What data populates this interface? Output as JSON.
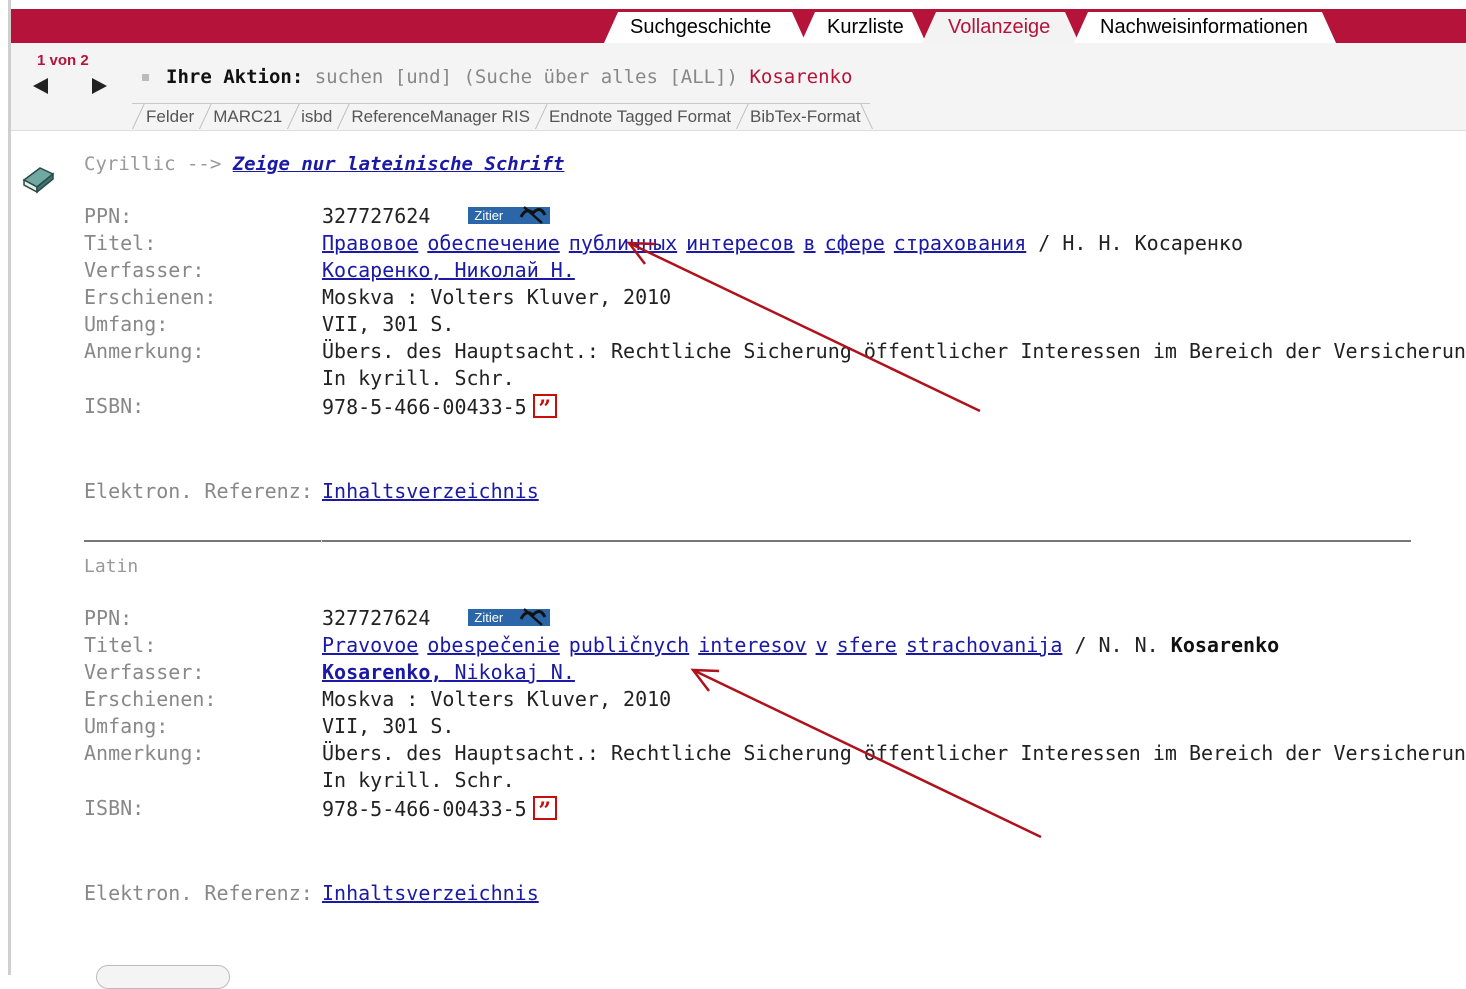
{
  "tabs": [
    {
      "label": "Suchgeschichte"
    },
    {
      "label": "Kurzliste"
    },
    {
      "label": "Vollanzeige"
    },
    {
      "label": "Nachweisinformationen"
    }
  ],
  "hitcount": "1 von 2",
  "action": {
    "label": "Ihre Aktion:",
    "query": "suchen [und] (Suche über alles [ALL])",
    "term": "Kosarenko"
  },
  "formats": [
    "Felder",
    "MARC21",
    "isbd",
    "ReferenceManager RIS",
    "Endnote Tagged Format",
    "BibTex-Format"
  ],
  "script_switch": {
    "prefix": "Cyrillic -->",
    "link": "Zeige nur lateinische Schrift"
  },
  "labels": {
    "ppn": "PPN:",
    "titel": "Titel:",
    "verfasser": "Verfasser:",
    "erschienen": "Erschienen:",
    "umfang": "Umfang:",
    "anmerkung": "Anmerkung:",
    "isbn": "ISBN:",
    "eref": "Elektron. Referenz:"
  },
  "zitier_label": "Zitier",
  "cyrillic": {
    "ppn": "327727624",
    "title_words": [
      "Правовое",
      "обеспечение",
      "публичных",
      "интересов",
      "в",
      "сфере",
      "страхования"
    ],
    "title_resp": "/ Н. Н. Косаренко",
    "author": "Косаренко, Николай Н.",
    "published": "Moskva : Volters Kluver, 2010",
    "extent": "VII, 301 S.",
    "note1": "Übers. des Hauptsacht.: Rechtliche Sicherung öffentlicher Interessen im Bereich der Versicherung",
    "note2": "In kyrill. Schr.",
    "isbn": "978-5-466-00433-5",
    "eref": "Inhaltsverzeichnis"
  },
  "latin": {
    "heading": "Latin",
    "ppn": "327727624",
    "title_words": [
      "Pravovoe",
      "obespečenie",
      "publičnych",
      "interesov",
      "v",
      "sfere",
      "strachovanija"
    ],
    "title_resp_prefix": "/ N. N.",
    "title_resp_bold": "Kosarenko",
    "author_bold": "Kosarenko,",
    "author_rest": "Nikokaj N.",
    "published": "Moskva : Volters Kluver, 2010",
    "extent": "VII, 301 S.",
    "note1": "Übers. des Hauptsacht.: Rechtliche Sicherung öffentlicher Interessen im Bereich der Versicherung",
    "note2": "In kyrill. Schr.",
    "isbn": "978-5-466-00433-5",
    "eref": "Inhaltsverzeichnis"
  },
  "colors": {
    "brand": "#b5133a",
    "link": "#1a1aa6",
    "annotation_arrow": "#b0121c"
  }
}
